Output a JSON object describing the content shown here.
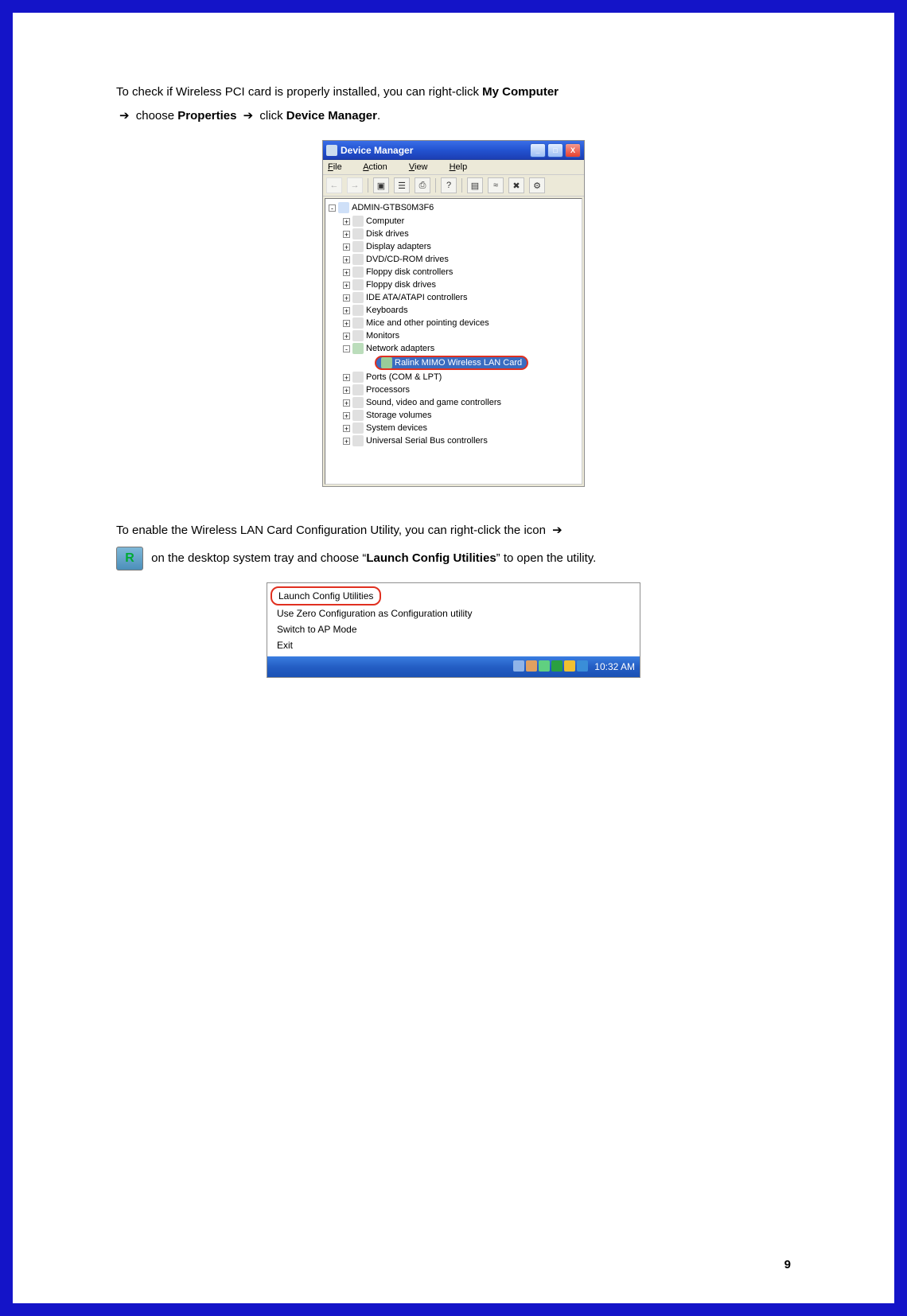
{
  "instructions": {
    "line1_pre": "To check if Wireless PCI card is properly installed, you can right-click ",
    "line1_b1": "My Computer",
    "line2_sep1": " choose ",
    "line2_b1": "Properties",
    "line2_sep2": " click ",
    "line2_b2": "Device Manager",
    "line2_end": "."
  },
  "window": {
    "title": "Device Manager",
    "menus": {
      "file": "File",
      "action": "Action",
      "view": "View",
      "help": "Help"
    },
    "root_label": "ADMIN-GTBS0M3F6",
    "nodes": [
      "Computer",
      "Disk drives",
      "Display adapters",
      "DVD/CD-ROM drives",
      "Floppy disk controllers",
      "Floppy disk drives",
      "IDE ATA/ATAPI controllers",
      "Keyboards",
      "Mice and other pointing devices",
      "Monitors",
      "Network adapters",
      "Ports (COM & LPT)",
      "Processors",
      "Sound, video and game controllers",
      "Storage volumes",
      "System devices",
      "Universal Serial Bus controllers"
    ],
    "highlighted_child": "Ralink MIMO Wireless LAN Card"
  },
  "instructions2": {
    "line_pre": "To enable the Wireless LAN Card Configuration Utility, you can right-click the icon ",
    "line_post1": " on the desktop system tray and choose “",
    "line_b1": "Launch Config Utilities",
    "line_post2": "” to open the utility."
  },
  "context_menu": {
    "items": [
      "Launch Config Utilities",
      "Use Zero Configuration as Configuration utility",
      "Switch to AP Mode",
      "Exit"
    ],
    "time": "10:32 AM"
  },
  "tray_colors": [
    "#8fb4e8",
    "#e0a060",
    "#60d080",
    "#2aa040",
    "#f0c030",
    "#3a8ed8"
  ],
  "page_number": "9"
}
